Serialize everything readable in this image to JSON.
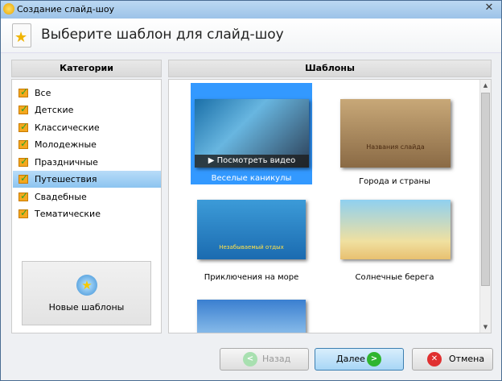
{
  "window": {
    "title": "Создание слайд-шоу",
    "close": "✕"
  },
  "header": {
    "title": "Выберите шаблон для слайд-шоу"
  },
  "categories": {
    "title": "Категории",
    "items": [
      "Все",
      "Детские",
      "Классические",
      "Молодежные",
      "Праздничные",
      "Путешествия",
      "Свадебные",
      "Тематические"
    ],
    "selected": "Путешествия"
  },
  "new_templates": "Новые шаблоны",
  "templates": {
    "title": "Шаблоны",
    "items": [
      {
        "label": "Веселые каникулы",
        "overlay": "Посмотреть видео",
        "selected": true
      },
      {
        "label": "Города и страны",
        "caption": "Названия слайда"
      },
      {
        "label": "Приключения на море",
        "caption": "Незабываемый отдых"
      },
      {
        "label": "Солнечные берега"
      },
      {
        "label": ""
      }
    ]
  },
  "buttons": {
    "back": "Назад",
    "next": "Далее",
    "cancel": "Отмена"
  },
  "colors": {
    "selection": "#3399ff",
    "accent": "#8cc4f0"
  }
}
